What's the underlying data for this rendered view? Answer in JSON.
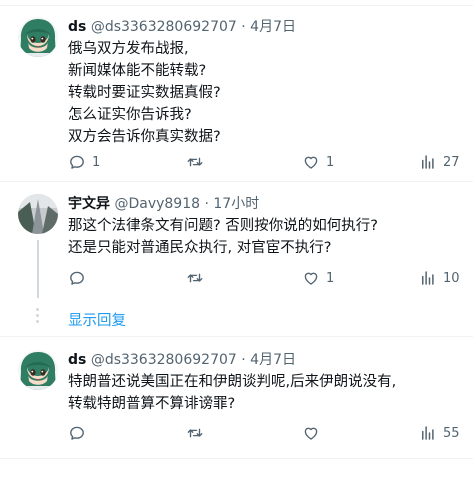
{
  "tweets": [
    {
      "name": "ds",
      "handle": "@ds3363280692707",
      "sep": "·",
      "time": "4月7日",
      "lines": [
        "俄乌双方发布战报,",
        "新闻媒体能不能转载?",
        "转载时要证实数据真假?",
        "怎么证实你告诉我?",
        "双方会告诉你真实数据?"
      ],
      "replies": "1",
      "retweets": "",
      "likes": "1",
      "views": "27"
    },
    {
      "name": "宇文异",
      "handle": "@Davy8918",
      "sep": "·",
      "time": "17小时",
      "lines": [
        "那这个法律条文有问题? 否则按你说的如何执行?",
        "还是只能对普通民众执行, 对官宦不执行?"
      ],
      "replies": "",
      "retweets": "",
      "likes": "1",
      "views": "10"
    },
    {
      "name": "ds",
      "handle": "@ds3363280692707",
      "sep": "·",
      "time": "4月7日",
      "lines": [
        "特朗普还说美国正在和伊朗谈判呢,后来伊朗说没有,",
        "转载特朗普算不算诽谤罪?"
      ],
      "replies": "",
      "retweets": "",
      "likes": "",
      "views": "55"
    }
  ],
  "show_replies": "显示回复",
  "icons": {
    "reply": "reply-icon",
    "retweet": "retweet-icon",
    "like": "heart-icon",
    "views": "views-chart-icon"
  },
  "colors": {
    "link": "#1d9bf0",
    "muted": "#536471",
    "text": "#0f1419",
    "border": "#eff3f4"
  }
}
